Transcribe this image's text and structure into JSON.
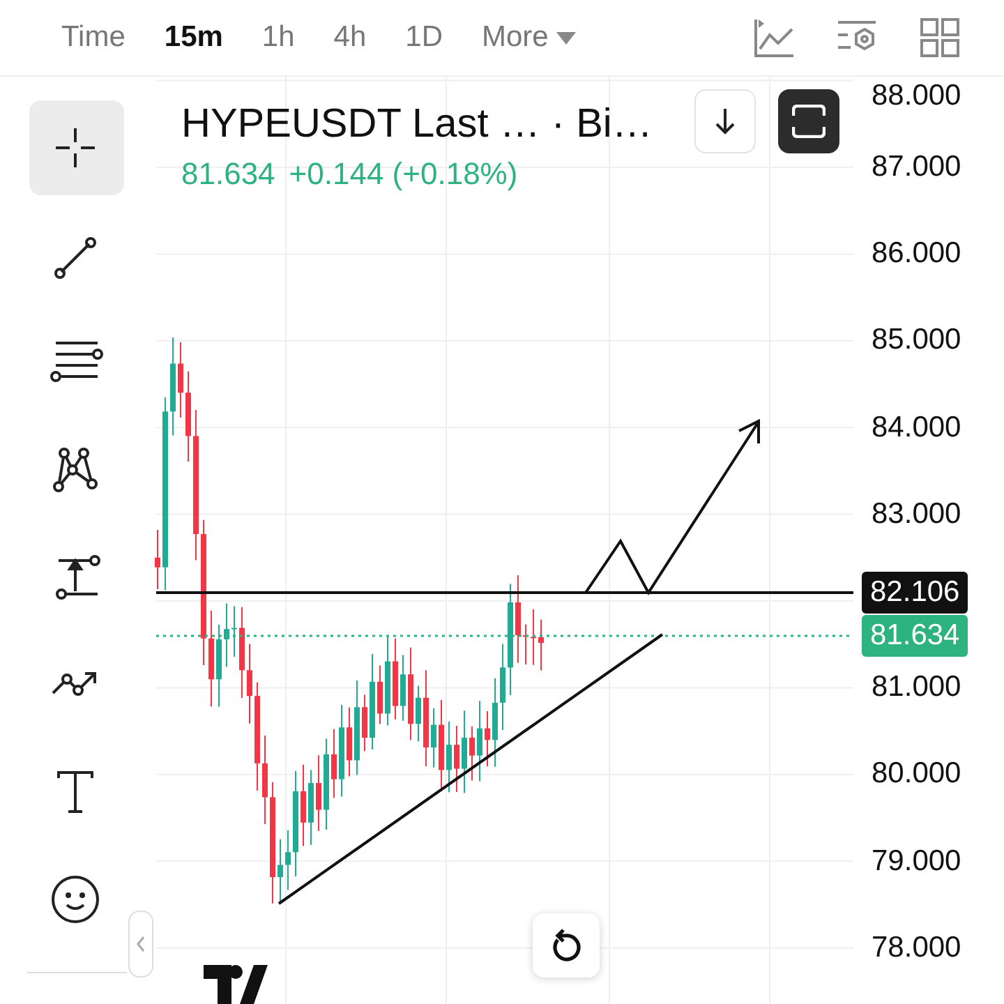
{
  "timeframes": [
    {
      "label": "Time",
      "selected": false
    },
    {
      "label": "15m",
      "selected": true
    },
    {
      "label": "1h",
      "selected": false
    },
    {
      "label": "4h",
      "selected": false
    },
    {
      "label": "1D",
      "selected": false
    }
  ],
  "more_menu": {
    "label": "More"
  },
  "drawing_tools": [
    {
      "kind": "crosshair",
      "selected": true
    },
    {
      "kind": "trend-line",
      "selected": false
    },
    {
      "kind": "fib",
      "selected": false
    },
    {
      "kind": "pattern",
      "selected": false
    },
    {
      "kind": "measure",
      "selected": false
    },
    {
      "kind": "path",
      "selected": false
    },
    {
      "kind": "text",
      "selected": false
    },
    {
      "kind": "emoji",
      "selected": false
    }
  ],
  "legend": {
    "symbol": "HYPEUSDT Last … · Bi…",
    "price": "81.634",
    "change": "+0.144 (+0.18%)"
  },
  "price_axis": {
    "ticks": [
      "88.000",
      "87.000",
      "86.000",
      "85.000",
      "84.000",
      "83.000",
      "81.000",
      "80.000",
      "79.000",
      "78.000"
    ]
  },
  "price_labels": [
    {
      "value": "82.106",
      "kind": "line"
    },
    {
      "value": "81.634",
      "kind": "last"
    }
  ]
}
